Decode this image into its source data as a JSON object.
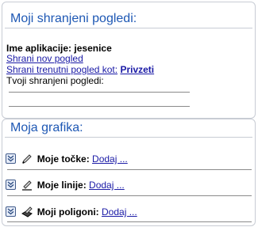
{
  "views_panel": {
    "title": "Moji shranjeni pogledi:",
    "app_label": "Ime aplikacije:",
    "app_name": "jesenice",
    "save_new_view": "Shrani nov pogled",
    "save_current_view": "Shrani trenutni pogled kot:",
    "save_current_view_action": "Privzeti",
    "saved_views_label": "Tvoji shranjeni pogledi:"
  },
  "graphics_panel": {
    "title": "Moja grafika:",
    "items": [
      {
        "label": "Moje točke:",
        "action": "Dodaj ..."
      },
      {
        "label": "Moje linije:",
        "action": "Dodaj ..."
      },
      {
        "label": "Moji poligoni:",
        "action": "Dodaj ..."
      }
    ]
  },
  "colors": {
    "title": "#1e58b4",
    "link": "#1a1aa6",
    "border": "#c8ccd4"
  }
}
